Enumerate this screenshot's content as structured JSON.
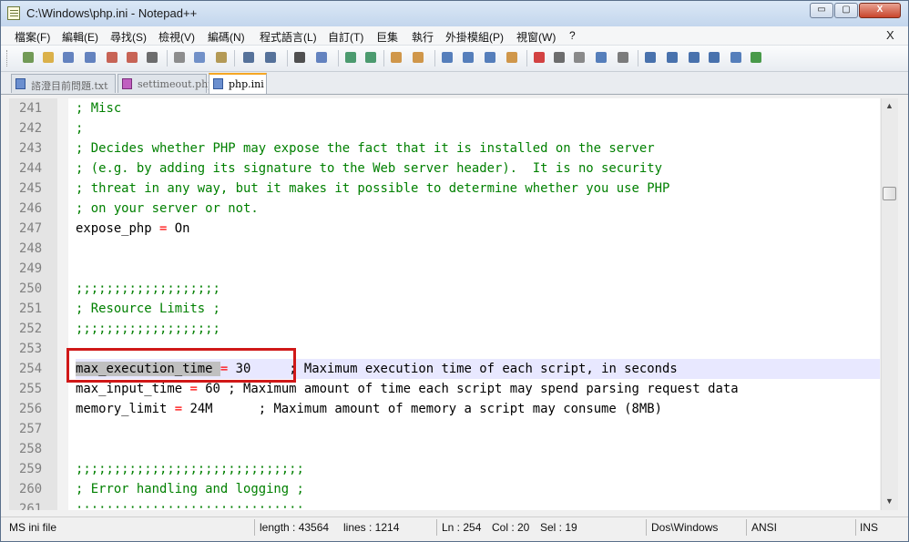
{
  "window": {
    "title": "C:\\Windows\\php.ini - Notepad++",
    "minimize": "▭",
    "maximize": "▢",
    "close": "X"
  },
  "menu": {
    "items": [
      "檔案(F)",
      "編輯(E)",
      "尋找(S)",
      "檢視(V)",
      "編碼(N)",
      "程式語言(L)",
      "自訂(T)",
      "巨集",
      "執行",
      "外掛模組(P)",
      "視窗(W)",
      "?"
    ],
    "close": "X"
  },
  "tabs": [
    {
      "label": "諮澄目前問題.txt",
      "icon": "floppy-disk-blue-icon"
    },
    {
      "label": "settimeout.php",
      "icon": "floppy-disk-pink-icon"
    },
    {
      "label": "php.ini",
      "icon": "floppy-disk-blue-icon"
    }
  ],
  "editor": {
    "highlight_color": "#d01818",
    "comment_color": "#008000",
    "operator_color": "#ff0000",
    "lines": [
      {
        "num": "241",
        "parts": [
          {
            "t": "; Misc",
            "c": "c"
          }
        ]
      },
      {
        "num": "242",
        "parts": [
          {
            "t": ";",
            "c": "c"
          }
        ]
      },
      {
        "num": "243",
        "parts": [
          {
            "t": "; Decides whether PHP may expose the fact that it is installed on the server",
            "c": "c"
          }
        ]
      },
      {
        "num": "244",
        "parts": [
          {
            "t": "; (e.g. by adding its signature to the Web server header).  It is no security",
            "c": "c"
          }
        ]
      },
      {
        "num": "245",
        "parts": [
          {
            "t": "; threat in any way, but it makes it possible to determine whether you use PHP",
            "c": "c"
          }
        ]
      },
      {
        "num": "246",
        "parts": [
          {
            "t": "; on your server or not.",
            "c": "c"
          }
        ]
      },
      {
        "num": "247",
        "parts": [
          {
            "t": "expose_php ",
            "c": ""
          },
          {
            "t": "=",
            "c": "op"
          },
          {
            "t": " On",
            "c": ""
          }
        ]
      },
      {
        "num": "248",
        "parts": []
      },
      {
        "num": "249",
        "parts": []
      },
      {
        "num": "250",
        "parts": [
          {
            "t": ";;;;;;;;;;;;;;;;;;;",
            "c": "c"
          }
        ]
      },
      {
        "num": "251",
        "parts": [
          {
            "t": "; Resource Limits ;",
            "c": "c"
          }
        ]
      },
      {
        "num": "252",
        "parts": [
          {
            "t": ";;;;;;;;;;;;;;;;;;;",
            "c": "c"
          }
        ]
      },
      {
        "num": "253",
        "parts": []
      },
      {
        "num": "254",
        "current": true,
        "parts": [
          {
            "t": "max_execution_time",
            "c": "sel"
          },
          {
            "t": " ",
            "c": "sel"
          },
          {
            "t": "=",
            "c": "op"
          },
          {
            "t": " 30     ",
            "c": ""
          },
          {
            "t": "; Maximum execution time of each script, in seconds",
            "c": ""
          }
        ]
      },
      {
        "num": "255",
        "parts": [
          {
            "t": "max_input_time ",
            "c": ""
          },
          {
            "t": "=",
            "c": "op"
          },
          {
            "t": " 60 ; Maximum amount of time each script may spend parsing request data",
            "c": ""
          }
        ]
      },
      {
        "num": "256",
        "parts": [
          {
            "t": "memory_limit ",
            "c": ""
          },
          {
            "t": "=",
            "c": "op"
          },
          {
            "t": " 24M      ; Maximum amount of memory a script may consume (8MB)",
            "c": ""
          }
        ]
      },
      {
        "num": "257",
        "parts": []
      },
      {
        "num": "258",
        "parts": []
      },
      {
        "num": "259",
        "parts": [
          {
            "t": ";;;;;;;;;;;;;;;;;;;;;;;;;;;;;;",
            "c": "c"
          }
        ]
      },
      {
        "num": "260",
        "parts": [
          {
            "t": "; Error handling and logging ;",
            "c": "c"
          }
        ]
      },
      {
        "num": "261",
        "parts": [
          {
            "t": ";;;;;;;;;;;;;;;;;;;;;;;;;;;;;;",
            "c": "c"
          }
        ]
      }
    ]
  },
  "status": {
    "filetype": "MS ini file",
    "length": "length : 43564",
    "lines": "lines : 1214",
    "ln": "Ln : 254",
    "col": "Col : 20",
    "sel": "Sel : 19",
    "eol": "Dos\\Windows",
    "encoding": "ANSI",
    "mode": "INS"
  },
  "toolbar": {
    "icons": [
      "new-file-icon",
      "open-file-icon",
      "save-icon",
      "save-all-icon",
      "close-icon",
      "close-all-icon",
      "print-icon",
      "cut-icon",
      "copy-icon",
      "paste-icon",
      "undo-icon",
      "redo-icon",
      "find-icon",
      "replace-icon",
      "zoom-in-icon",
      "zoom-out-icon",
      "sync-vertical-icon",
      "sync-horizontal-icon",
      "word-wrap-icon",
      "show-all-chars-icon",
      "indent-guide-icon",
      "user-lang-icon",
      "record-macro-icon",
      "stop-record-icon",
      "play-macro-icon",
      "run-macro-multiple-icon",
      "save-macro-icon",
      "nav-first-icon",
      "nav-up-icon",
      "nav-down-icon",
      "nav-last-icon",
      "spell-check-icon",
      "tick-icon"
    ]
  }
}
